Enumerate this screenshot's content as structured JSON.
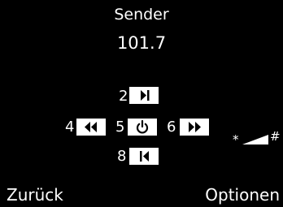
{
  "header": {
    "title": "Sender",
    "frequency": "101.7"
  },
  "keypad": {
    "key2": {
      "number": "2",
      "icon": "skip-forward-icon"
    },
    "key4": {
      "number": "4",
      "icon": "rewind-icon"
    },
    "key5": {
      "number": "5",
      "icon": "power-icon"
    },
    "key6": {
      "number": "6",
      "icon": "fast-forward-icon"
    },
    "key8": {
      "number": "8",
      "icon": "skip-back-icon"
    }
  },
  "volume": {
    "down_key": "*",
    "up_key": "#",
    "icon": "volume-ramp-icon"
  },
  "softkeys": {
    "left": "Zurück",
    "right": "Optionen"
  },
  "colors": {
    "background": "#000000",
    "foreground": "#ffffff"
  }
}
